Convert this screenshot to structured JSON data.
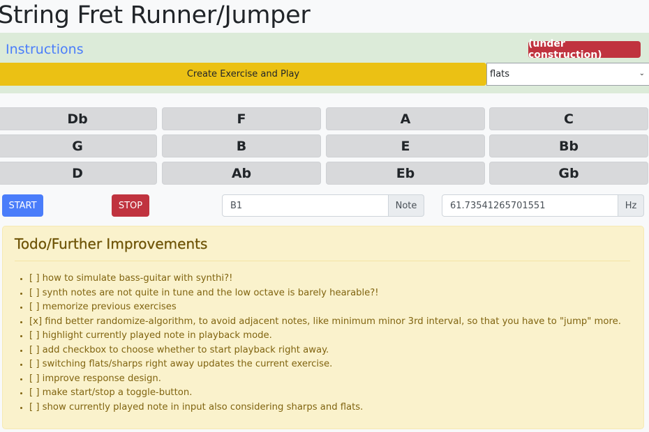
{
  "header": {
    "title": "String Fret Runner/Jumper"
  },
  "instructions": {
    "link_label": "Instructions",
    "badge": "(under construction)",
    "create_button": "Create Exercise and Play",
    "accidental_select": {
      "selected": "flats"
    }
  },
  "note_buttons": [
    [
      "Db",
      "F",
      "A",
      "C"
    ],
    [
      "G",
      "B",
      "E",
      "Bb"
    ],
    [
      "D",
      "Ab",
      "Eb",
      "Gb"
    ]
  ],
  "playback": {
    "start_label": "START",
    "stop_label": "STOP",
    "note_value": "B1",
    "note_addon": "Note",
    "freq_value": "61.73541265701551",
    "freq_addon": "Hz"
  },
  "todo": {
    "title": "Todo/Further Improvements",
    "items": [
      "[ ] how to simulate bass-guitar with synthi?!",
      "[ ] synth notes are not quite in tune and the low octave is barely hearable?!",
      "[ ] memorize previous exercises",
      "[x] find better randomize-algorithm, to avoid adjacent notes, like minimum minor 3rd interval, so that you have to \"jump\" more.",
      "[ ] highlight currently played note in playback mode.",
      "[ ] add checkbox to choose whether to start playback right away.",
      "[ ] switching flats/sharps right away updates the current exercise.",
      "[ ] improve response design.",
      "[ ] make start/stop a toggle-button.",
      "[ ] show currently played note in input also considering sharps and flats."
    ]
  },
  "colors": {
    "primary": "#4a7dfa",
    "danger": "#c0333f",
    "warning": "#ebc114",
    "success_bg": "#dcebd9",
    "todo_bg": "#faf2cc",
    "note_btn_bg": "#d8d9db"
  }
}
